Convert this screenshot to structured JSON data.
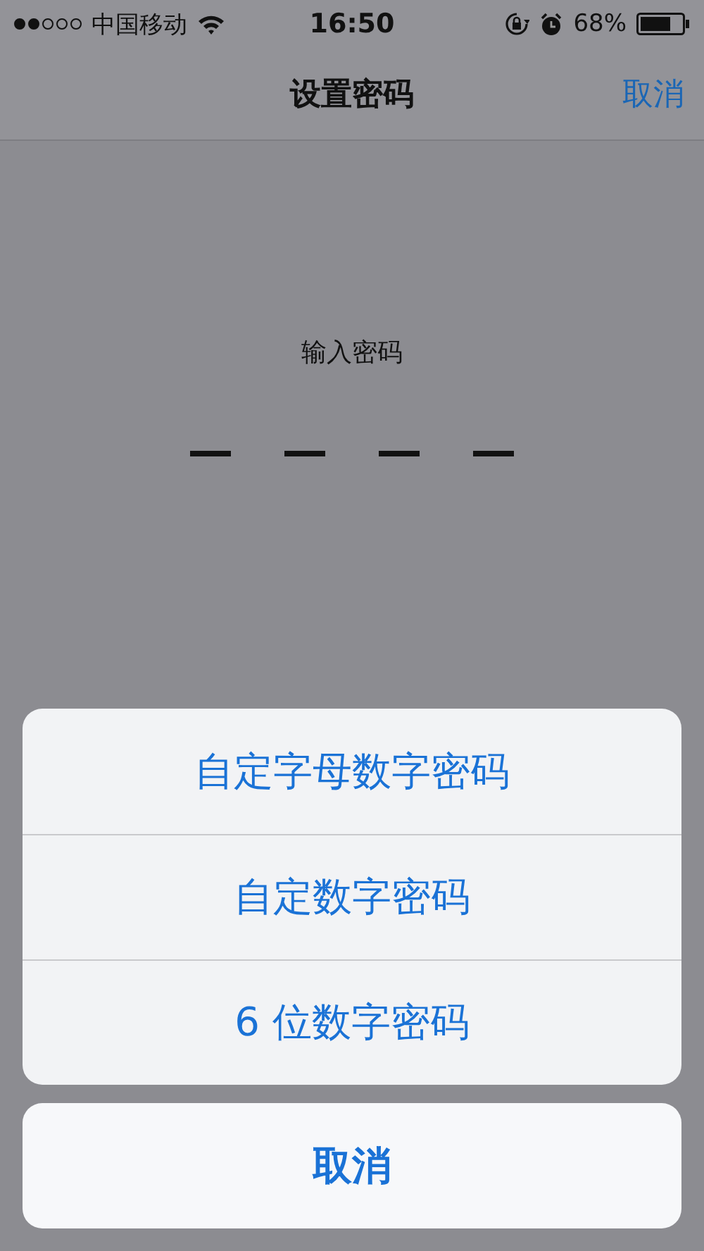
{
  "status_bar": {
    "signal_dots": [
      {
        "filled": true
      },
      {
        "filled": true
      },
      {
        "filled": false
      },
      {
        "filled": false
      },
      {
        "filled": false
      }
    ],
    "carrier": "中国移动",
    "time": "16:50",
    "battery_percent": "68%"
  },
  "nav_bar": {
    "title": "设置密码",
    "cancel": "取消"
  },
  "passcode": {
    "prompt": "输入密码",
    "digits": [
      {
        "entered": false
      },
      {
        "entered": false
      },
      {
        "entered": false
      },
      {
        "entered": false
      }
    ]
  },
  "action_sheet": {
    "options": [
      {
        "label": "自定字母数字密码"
      },
      {
        "label": "自定数字密码"
      },
      {
        "label": "6 位数字密码"
      }
    ],
    "cancel": "取消"
  }
}
